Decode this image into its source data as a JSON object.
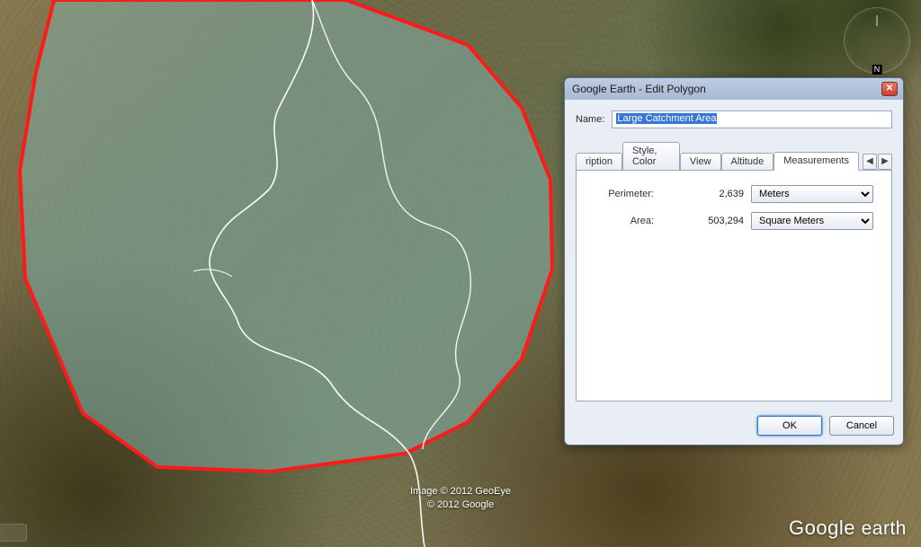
{
  "attribution": {
    "line1": "Image © 2012 GeoEye",
    "line2": "© 2012 Google"
  },
  "watermark": {
    "brand": "Google",
    "product": "earth"
  },
  "compass": {
    "north_label": "N"
  },
  "dialog": {
    "title": "Google Earth - Edit Polygon",
    "close_glyph": "✕",
    "name_label": "Name:",
    "name_value": "Large Catchment Area",
    "tabs": {
      "description_truncated": "ription",
      "style_color": "Style, Color",
      "view": "View",
      "altitude": "Altitude",
      "measurements": "Measurements",
      "prev_glyph": "◀",
      "next_glyph": "▶"
    },
    "measurements": {
      "perimeter_label": "Perimeter:",
      "perimeter_value": "2,639",
      "perimeter_unit": "Meters",
      "area_label": "Area:",
      "area_value": "503,294",
      "area_unit": "Square Meters"
    },
    "buttons": {
      "ok": "OK",
      "cancel": "Cancel"
    }
  }
}
